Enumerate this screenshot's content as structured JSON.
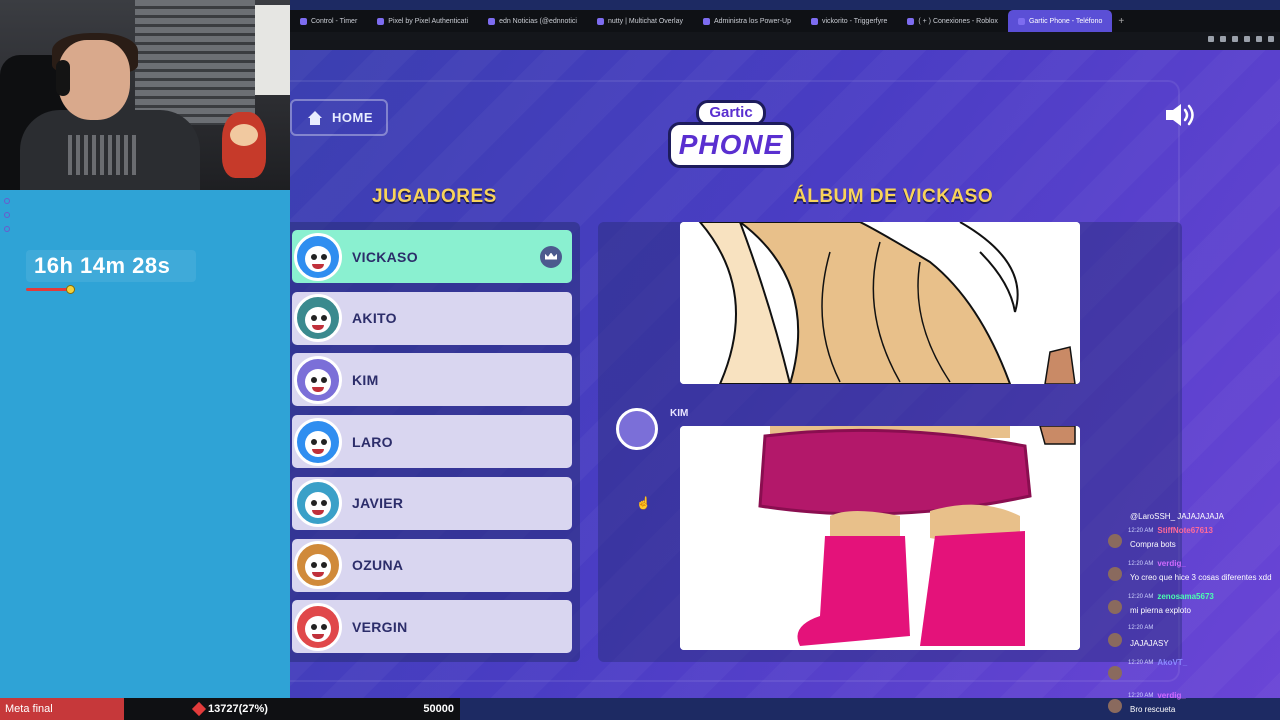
{
  "browser": {
    "tabs": [
      {
        "label": "Control - Timer"
      },
      {
        "label": "Pixel by Pixel Authenticati"
      },
      {
        "label": "edn Noticias (@ednnotici"
      },
      {
        "label": "nutty | Multichat Overlay"
      },
      {
        "label": "Administra los Power-Up"
      },
      {
        "label": "vickorito - Triggerfyre"
      },
      {
        "label": "( + ) Conexiones - Roblox"
      },
      {
        "label": "Gartic Phone - Teléfono"
      }
    ]
  },
  "overlay": {
    "timer": "16h 14m 28s",
    "timer_progress": 0.12,
    "goal_label": "Meta final",
    "goal_current": "13727(27%)",
    "goal_target": "50000"
  },
  "game": {
    "home_label": "HOME",
    "logo_top": "Gartic",
    "logo_main": "PHONE",
    "players_title": "JUGADORES",
    "album_title": "ÁLBUM DE VICKASO",
    "players": [
      {
        "name": "VICKASO",
        "host": true,
        "color": "#2f8ef0"
      },
      {
        "name": "AKITO",
        "host": false,
        "color": "#3a8a8e"
      },
      {
        "name": "KIM",
        "host": false,
        "color": "#7b6fd8"
      },
      {
        "name": "LARO",
        "host": false,
        "color": "#2f8ef0"
      },
      {
        "name": "JAVIER",
        "host": false,
        "color": "#3aa0c8"
      },
      {
        "name": "OZUNA",
        "host": false,
        "color": "#d08a3a"
      },
      {
        "name": "VERGIN",
        "host": false,
        "color": "#e0484a"
      }
    ],
    "album_author": "KIM"
  },
  "chat": {
    "first_line": "@LaroSSH_ JAJAJAJAJA",
    "messages": [
      {
        "time": "12:20 AM",
        "user": "StiffNote67613",
        "user_color": "#ff6a9a",
        "text": "Compra bots"
      },
      {
        "time": "12:20 AM",
        "user": "verdig_",
        "user_color": "#d06aff",
        "text": "Yo creo que hice 3 cosas diferentes xdd"
      },
      {
        "time": "12:20 AM",
        "user": "zenosama5673",
        "user_color": "#4affb0",
        "text": "mi pierna exploto"
      },
      {
        "time": "12:20 AM",
        "user": "",
        "user_color": "#34c96a",
        "text": "JAJAJASY"
      },
      {
        "time": "12:20 AM",
        "user": "AkoVT_",
        "user_color": "#8a8aff",
        "text": ""
      },
      {
        "time": "12:20 AM",
        "user": "verdig_",
        "user_color": "#d06aff",
        "text": "Bro rescueta"
      }
    ]
  }
}
